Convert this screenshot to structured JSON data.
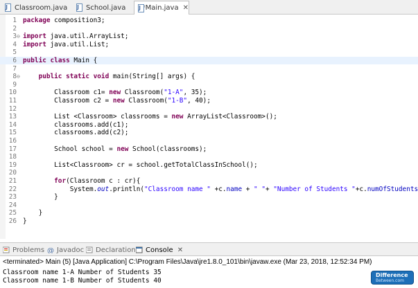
{
  "tabs": [
    {
      "label": "Classroom.java",
      "active": false
    },
    {
      "label": "School.java",
      "active": false
    },
    {
      "label": "*Main.java",
      "active": true,
      "close": "✕"
    }
  ],
  "editor": {
    "lines": [
      {
        "n": "1",
        "fold": "",
        "text": "package composition3;"
      },
      {
        "n": "2",
        "fold": "",
        "text": ""
      },
      {
        "n": "3",
        "fold": "⊖",
        "text": "import java.util.ArrayList;"
      },
      {
        "n": "4",
        "fold": "",
        "text": "import java.util.List;"
      },
      {
        "n": "5",
        "fold": "",
        "text": ""
      },
      {
        "n": "6",
        "fold": "",
        "text": "public class Main {"
      },
      {
        "n": "7",
        "fold": "",
        "text": ""
      },
      {
        "n": "8",
        "fold": "⊖",
        "text": "    public static void main(String[] args) {"
      },
      {
        "n": "9",
        "fold": "",
        "text": ""
      },
      {
        "n": "10",
        "fold": "",
        "text": "        Classroom c1= new Classroom(\"1-A\", 35);"
      },
      {
        "n": "11",
        "fold": "",
        "text": "        Classroom c2 = new Classroom(\"1-B\", 40);"
      },
      {
        "n": "12",
        "fold": "",
        "text": ""
      },
      {
        "n": "13",
        "fold": "",
        "text": "        List <Classroom> classrooms = new ArrayList<Classroom>();"
      },
      {
        "n": "14",
        "fold": "",
        "text": "        classrooms.add(c1);"
      },
      {
        "n": "15",
        "fold": "",
        "text": "        classrooms.add(c2);"
      },
      {
        "n": "16",
        "fold": "",
        "text": ""
      },
      {
        "n": "17",
        "fold": "",
        "text": "        School school = new School(classrooms);"
      },
      {
        "n": "18",
        "fold": "",
        "text": ""
      },
      {
        "n": "19",
        "fold": "",
        "text": "        List<Classroom> cr = school.getTotalClassInSchool();"
      },
      {
        "n": "20",
        "fold": "",
        "text": ""
      },
      {
        "n": "21",
        "fold": "",
        "text": "        for(Classroom c : cr){"
      },
      {
        "n": "22",
        "fold": "",
        "text": "            System.out.println(\"Classroom name \" +c.name + \" \"+ \"Number of Students \"+c.numOfStudents);"
      },
      {
        "n": "23",
        "fold": "",
        "text": "        }"
      },
      {
        "n": "24",
        "fold": "",
        "text": ""
      },
      {
        "n": "25",
        "fold": "",
        "text": "    }"
      },
      {
        "n": "26",
        "fold": "",
        "text": "}"
      }
    ]
  },
  "bottom_tabs": [
    {
      "label": "Problems",
      "icon": "problems-icon"
    },
    {
      "label": "Javadoc",
      "icon": "javadoc-icon"
    },
    {
      "label": "Declaration",
      "icon": "declaration-icon"
    },
    {
      "label": "Console",
      "icon": "console-icon",
      "active": true,
      "close": "✕"
    }
  ],
  "console": {
    "terminated": "<terminated> Main (5) [Java Application] C:\\Program Files\\Java\\jre1.8.0_101\\bin\\javaw.exe (Mar 23, 2018, 12:52:34 PM)",
    "output": [
      "Classroom name 1-A Number of Students 35",
      "Classroom name 1-B Number of Students 40"
    ]
  },
  "watermark": {
    "line1": "Difference",
    "line2": "Between.com"
  },
  "colors": {
    "keyword": "#7f0055",
    "string": "#2a00ff",
    "field": "#0000c0",
    "highlight": "#e8f2fe"
  }
}
